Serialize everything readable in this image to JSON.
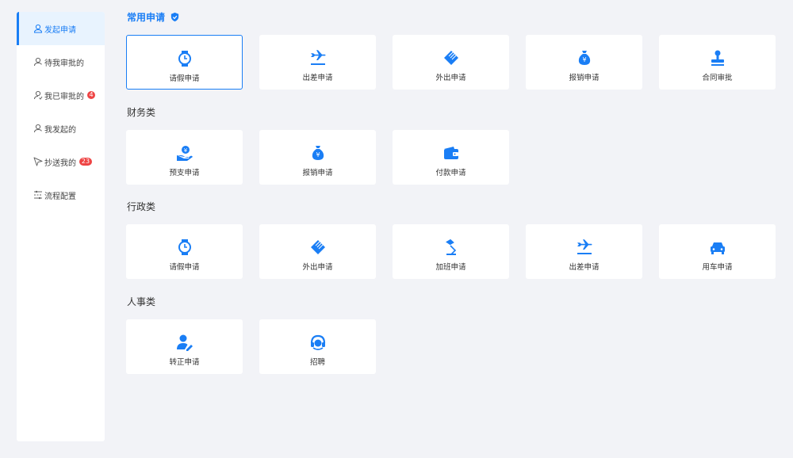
{
  "sidebar": {
    "items": [
      {
        "label": "发起申请",
        "icon": "user-icon",
        "active": true
      },
      {
        "label": "待我审批的",
        "icon": "user-icon"
      },
      {
        "label": "我已审批的",
        "icon": "user-check-icon",
        "badge": "4"
      },
      {
        "label": "我发起的",
        "icon": "user-icon"
      },
      {
        "label": "抄送我的",
        "icon": "send-icon",
        "badge": "23"
      },
      {
        "label": "流程配置",
        "icon": "settings-list-icon"
      }
    ]
  },
  "sections": [
    {
      "title": "常用申请",
      "icon": "shield-icon",
      "items": [
        {
          "label": "请假申请",
          "icon": "watch-icon"
        },
        {
          "label": "出差申请",
          "icon": "plane-icon"
        },
        {
          "label": "外出申请",
          "icon": "eraser-icon"
        },
        {
          "label": "报销申请",
          "icon": "money-bag-icon"
        },
        {
          "label": "合同审批",
          "icon": "stamp-icon"
        }
      ]
    },
    {
      "title": "财务类",
      "items": [
        {
          "label": "预支申请",
          "icon": "hand-money-icon"
        },
        {
          "label": "报销申请",
          "icon": "money-bag-icon"
        },
        {
          "label": "付款申请",
          "icon": "wallet-icon"
        }
      ]
    },
    {
      "title": "行政类",
      "items": [
        {
          "label": "请假申请",
          "icon": "watch-icon"
        },
        {
          "label": "外出申请",
          "icon": "eraser-icon"
        },
        {
          "label": "加班申请",
          "icon": "desk-lamp-icon"
        },
        {
          "label": "出差申请",
          "icon": "plane-icon"
        },
        {
          "label": "用车申请",
          "icon": "car-icon"
        }
      ]
    },
    {
      "title": "人事类",
      "items": [
        {
          "label": "转正申请",
          "icon": "user-edit-icon"
        },
        {
          "label": "招聘",
          "icon": "headset-icon"
        }
      ]
    }
  ],
  "colors": {
    "accent": "#1a7ef5",
    "badge": "#ee4444",
    "background": "#f2f3f7"
  }
}
